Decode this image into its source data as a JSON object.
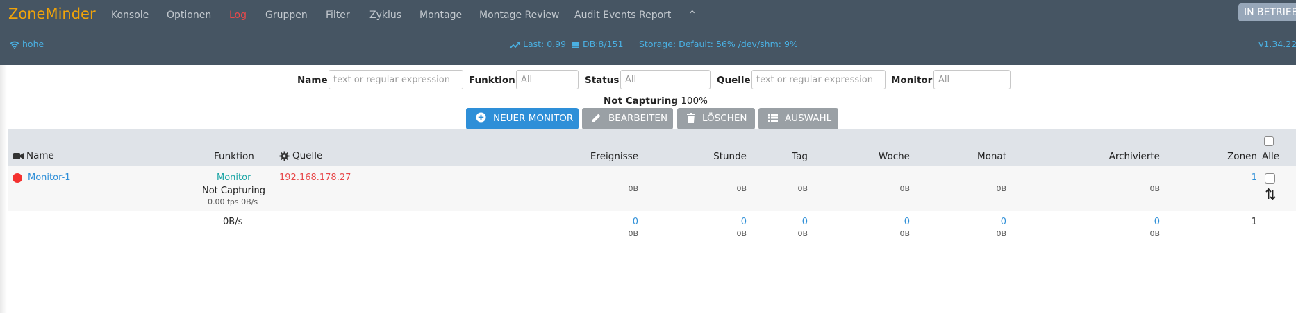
{
  "brand": "ZoneMinder",
  "menu": [
    "Konsole",
    "Optionen",
    "Log",
    "Gruppen",
    "Filter",
    "Zyklus",
    "Montage",
    "Montage Review",
    "Audit Events Report"
  ],
  "run_state": "IN BETRIEB",
  "status": {
    "host": "hohe",
    "load": "Last: 0.99",
    "db": "DB:8/151",
    "storage": "Storage: Default: 56% /dev/shm: 9%",
    "version": "v1.34.22"
  },
  "filters": {
    "name_label": "Name",
    "name_placeholder": "text or regular expression",
    "function_label": "Funktion",
    "function_value": "All",
    "status_label": "Status",
    "status_value": "All",
    "source_label": "Quelle",
    "source_placeholder": "text or regular expression",
    "monitor_label": "Monitor",
    "monitor_value": "All"
  },
  "capture_status": {
    "label": "Not Capturing",
    "value": "100%"
  },
  "buttons": {
    "new": "NEUER MONITOR",
    "edit": "BEARBEITEN",
    "delete": "LÖSCHEN",
    "select": "AUSWAHL"
  },
  "colors": {
    "nav": "#465563",
    "brand": "#f0a30a",
    "accent": "#2e8fd8",
    "active_menu": "#e8484a",
    "status_text": "#4ab0e2"
  },
  "table": {
    "headers": {
      "name": "Name",
      "function": "Funktion",
      "source": "Quelle",
      "events": "Ereignisse",
      "hour": "Stunde",
      "day": "Tag",
      "week": "Woche",
      "month": "Monat",
      "archived": "Archivierte",
      "zones": "Zonen",
      "all": "Alle"
    },
    "monitor": {
      "name": "Monitor-1",
      "function": "Monitor",
      "state": "Not Capturing",
      "fps": "0.00 fps 0B/s",
      "source": "192.168.178.27",
      "events": "0B",
      "hour": "0B",
      "day": "0B",
      "week": "0B",
      "month": "0B",
      "archived": "0B",
      "zones": "1"
    },
    "totals": {
      "bandwidth": "0B/s",
      "events": "0",
      "events_size": "0B",
      "hour": "0",
      "hour_size": "0B",
      "day": "0",
      "day_size": "0B",
      "week": "0",
      "week_size": "0B",
      "month": "0",
      "month_size": "0B",
      "archived": "0",
      "archived_size": "0B",
      "zones": "1"
    }
  }
}
